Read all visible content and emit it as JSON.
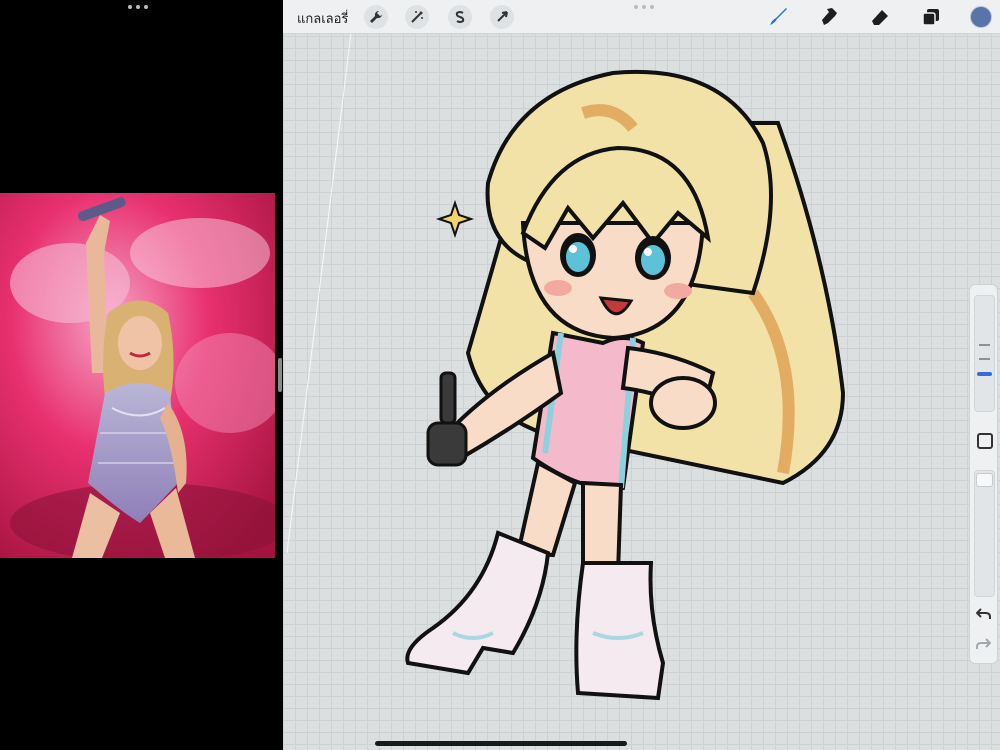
{
  "toolbar": {
    "gallery_label": "แกลเลอรี่",
    "left_tools": [
      "wrench-icon",
      "magic-wand-icon",
      "selection-s-icon",
      "transform-arrow-icon"
    ],
    "right_tools": [
      "brush-icon",
      "smudge-icon",
      "eraser-icon",
      "layers-icon"
    ],
    "active_tool": "brush-icon",
    "current_color": "#5a73a8",
    "accent_color": "#2f6fdb"
  },
  "sidebar": {
    "brush_size_level": 0.33,
    "modify_button": "square-modify-icon",
    "undo": "undo-icon",
    "redo": "redo-icon"
  },
  "reference_photo": {
    "background_color": "#e8306f"
  }
}
